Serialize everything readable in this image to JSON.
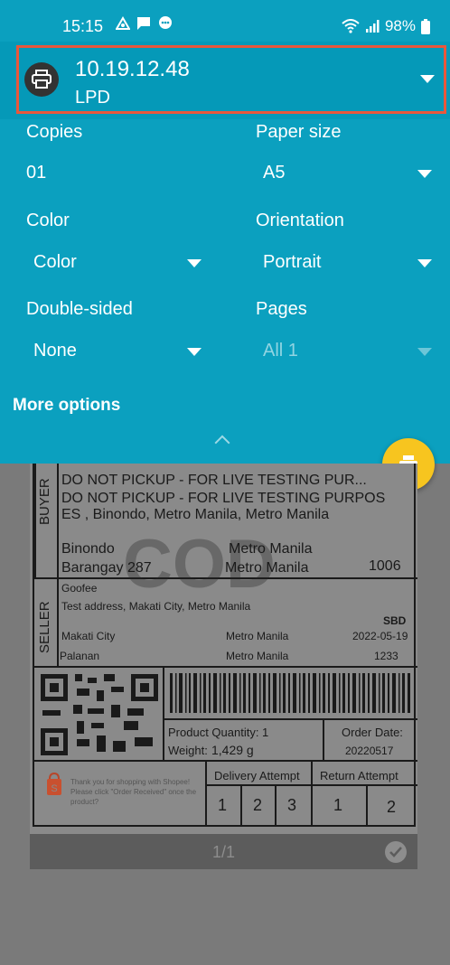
{
  "status": {
    "time": "15:15",
    "battery": "98%"
  },
  "printer": {
    "name": "10.19.12.48",
    "type": "LPD"
  },
  "options": {
    "copies_label": "Copies",
    "copies_value": "01",
    "paper_label": "Paper size",
    "paper_value": "A5",
    "color_label": "Color",
    "color_value": "Color",
    "orientation_label": "Orientation",
    "orientation_value": "Portrait",
    "duplex_label": "Double-sided",
    "duplex_value": "None",
    "pages_label": "Pages",
    "pages_value": "All 1",
    "more_options": "More options"
  },
  "shipping_label": {
    "buyer_tag": "BUYER",
    "seller_tag": "SELLER",
    "buyer_line1": "DO NOT PICKUP - FOR LIVE TESTING PUR...",
    "buyer_line2": "DO NOT PICKUP - FOR LIVE TESTING PURPOS",
    "buyer_line3": "ES , Binondo, Metro Manila, Metro Manila",
    "buyer_city": "Binondo",
    "buyer_region": "Metro Manila",
    "buyer_barangay": "Barangay 287",
    "buyer_region2": "Metro Manila",
    "buyer_zip": "1006",
    "watermark": "COD",
    "seller_name": "Goofee",
    "seller_address": "Test address, Makati City, Metro Manila",
    "sbd": "SBD",
    "seller_city": "Makati City",
    "seller_region": "Metro Manila",
    "seller_date": "2022-05-19",
    "seller_barangay": "Palanan",
    "seller_region2": "Metro Manila",
    "seller_zip": "1233",
    "qty_label": "Product Quantity:",
    "qty_value": "1",
    "weight_label": "Weight:",
    "weight_value": "1,429 g",
    "order_date_label": "Order Date:",
    "order_date_value": "20220517",
    "thanks_line1": "Thank you for shopping with Shopee!",
    "thanks_line2": "Please click \"Order Received\" once the",
    "thanks_line3": "product?",
    "delivery_attempt": "Delivery Attempt",
    "return_attempt": "Return Attempt",
    "d1": "1",
    "d2": "2",
    "d3": "3",
    "r1": "1",
    "r2": "2"
  },
  "pagebar": {
    "page": "1/1"
  },
  "colors": {
    "panel": "#0ba0bf",
    "highlight": "#e9573b",
    "fab": "#f7c51f"
  }
}
